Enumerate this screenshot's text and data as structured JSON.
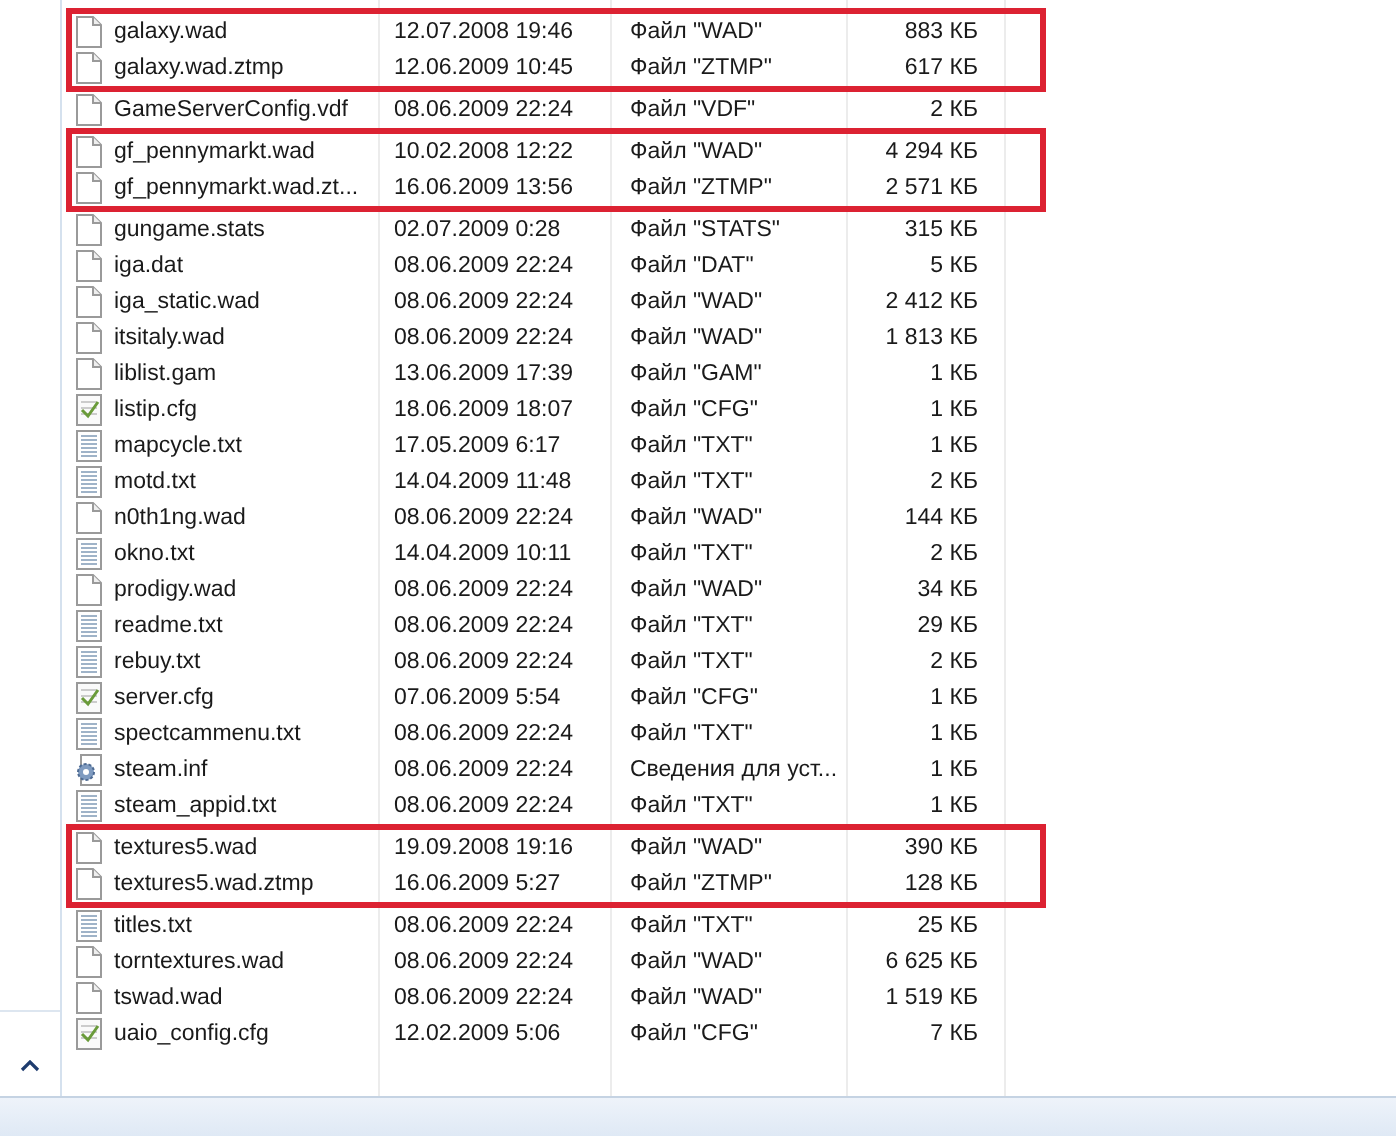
{
  "groups": [
    {
      "marked": true,
      "rows": [
        {
          "kind": "plain",
          "name": "galaxy.wad",
          "date": "12.07.2008 19:46",
          "type": "Файл \"WAD\"",
          "size": "883 КБ"
        },
        {
          "kind": "plain",
          "name": "galaxy.wad.ztmp",
          "date": "12.06.2009 10:45",
          "type": "Файл \"ZTMP\"",
          "size": "617 КБ"
        }
      ]
    },
    {
      "marked": false,
      "rows": [
        {
          "kind": "plain",
          "name": "GameServerConfig.vdf",
          "date": "08.06.2009 22:24",
          "type": "Файл \"VDF\"",
          "size": "2 КБ"
        }
      ]
    },
    {
      "marked": true,
      "rows": [
        {
          "kind": "plain",
          "name": "gf_pennymarkt.wad",
          "date": "10.02.2008 12:22",
          "type": "Файл \"WAD\"",
          "size": "4 294 КБ"
        },
        {
          "kind": "plain",
          "name": "gf_pennymarkt.wad.zt...",
          "date": "16.06.2009 13:56",
          "type": "Файл \"ZTMP\"",
          "size": "2 571 КБ"
        }
      ]
    },
    {
      "marked": false,
      "rows": [
        {
          "kind": "plain",
          "name": "gungame.stats",
          "date": "02.07.2009 0:28",
          "type": "Файл \"STATS\"",
          "size": "315 КБ"
        },
        {
          "kind": "plain",
          "name": "iga.dat",
          "date": "08.06.2009 22:24",
          "type": "Файл \"DAT\"",
          "size": "5 КБ"
        },
        {
          "kind": "plain",
          "name": "iga_static.wad",
          "date": "08.06.2009 22:24",
          "type": "Файл \"WAD\"",
          "size": "2 412 КБ"
        },
        {
          "kind": "plain",
          "name": "itsitaly.wad",
          "date": "08.06.2009 22:24",
          "type": "Файл \"WAD\"",
          "size": "1 813 КБ"
        },
        {
          "kind": "plain",
          "name": "liblist.gam",
          "date": "13.06.2009 17:39",
          "type": "Файл \"GAM\"",
          "size": "1 КБ"
        },
        {
          "kind": "config",
          "name": "listip.cfg",
          "date": "18.06.2009 18:07",
          "type": "Файл \"CFG\"",
          "size": "1 КБ"
        },
        {
          "kind": "text",
          "name": "mapcycle.txt",
          "date": "17.05.2009 6:17",
          "type": "Файл \"TXT\"",
          "size": "1 КБ"
        },
        {
          "kind": "text",
          "name": "motd.txt",
          "date": "14.04.2009 11:48",
          "type": "Файл \"TXT\"",
          "size": "2 КБ"
        },
        {
          "kind": "plain",
          "name": "n0th1ng.wad",
          "date": "08.06.2009 22:24",
          "type": "Файл \"WAD\"",
          "size": "144 КБ"
        },
        {
          "kind": "text",
          "name": "okno.txt",
          "date": "14.04.2009 10:11",
          "type": "Файл \"TXT\"",
          "size": "2 КБ"
        },
        {
          "kind": "plain",
          "name": "prodigy.wad",
          "date": "08.06.2009 22:24",
          "type": "Файл \"WAD\"",
          "size": "34 КБ"
        },
        {
          "kind": "text",
          "name": "readme.txt",
          "date": "08.06.2009 22:24",
          "type": "Файл \"TXT\"",
          "size": "29 КБ"
        },
        {
          "kind": "text",
          "name": "rebuy.txt",
          "date": "08.06.2009 22:24",
          "type": "Файл \"TXT\"",
          "size": "2 КБ"
        },
        {
          "kind": "config",
          "name": "server.cfg",
          "date": "07.06.2009 5:54",
          "type": "Файл \"CFG\"",
          "size": "1 КБ"
        },
        {
          "kind": "text",
          "name": "spectcammenu.txt",
          "date": "08.06.2009 22:24",
          "type": "Файл \"TXT\"",
          "size": "1 КБ"
        },
        {
          "kind": "setup",
          "name": "steam.inf",
          "date": "08.06.2009 22:24",
          "type": "Сведения для уст...",
          "size": "1 КБ"
        },
        {
          "kind": "text",
          "name": "steam_appid.txt",
          "date": "08.06.2009 22:24",
          "type": "Файл \"TXT\"",
          "size": "1 КБ"
        }
      ]
    },
    {
      "marked": true,
      "rows": [
        {
          "kind": "plain",
          "name": "textures5.wad",
          "date": "19.09.2008 19:16",
          "type": "Файл \"WAD\"",
          "size": "390 КБ"
        },
        {
          "kind": "plain",
          "name": "textures5.wad.ztmp",
          "date": "16.06.2009 5:27",
          "type": "Файл \"ZTMP\"",
          "size": "128 КБ"
        }
      ]
    },
    {
      "marked": false,
      "rows": [
        {
          "kind": "text",
          "name": "titles.txt",
          "date": "08.06.2009 22:24",
          "type": "Файл \"TXT\"",
          "size": "25 КБ"
        },
        {
          "kind": "plain",
          "name": "torntextures.wad",
          "date": "08.06.2009 22:24",
          "type": "Файл \"WAD\"",
          "size": "6 625 КБ"
        },
        {
          "kind": "plain",
          "name": "tswad.wad",
          "date": "08.06.2009 22:24",
          "type": "Файл \"WAD\"",
          "size": "1 519 КБ"
        },
        {
          "kind": "config",
          "name": "uaio_config.cfg",
          "date": "12.02.2009 5:06",
          "type": "Файл \"CFG\"",
          "size": "7 КБ"
        }
      ]
    }
  ]
}
